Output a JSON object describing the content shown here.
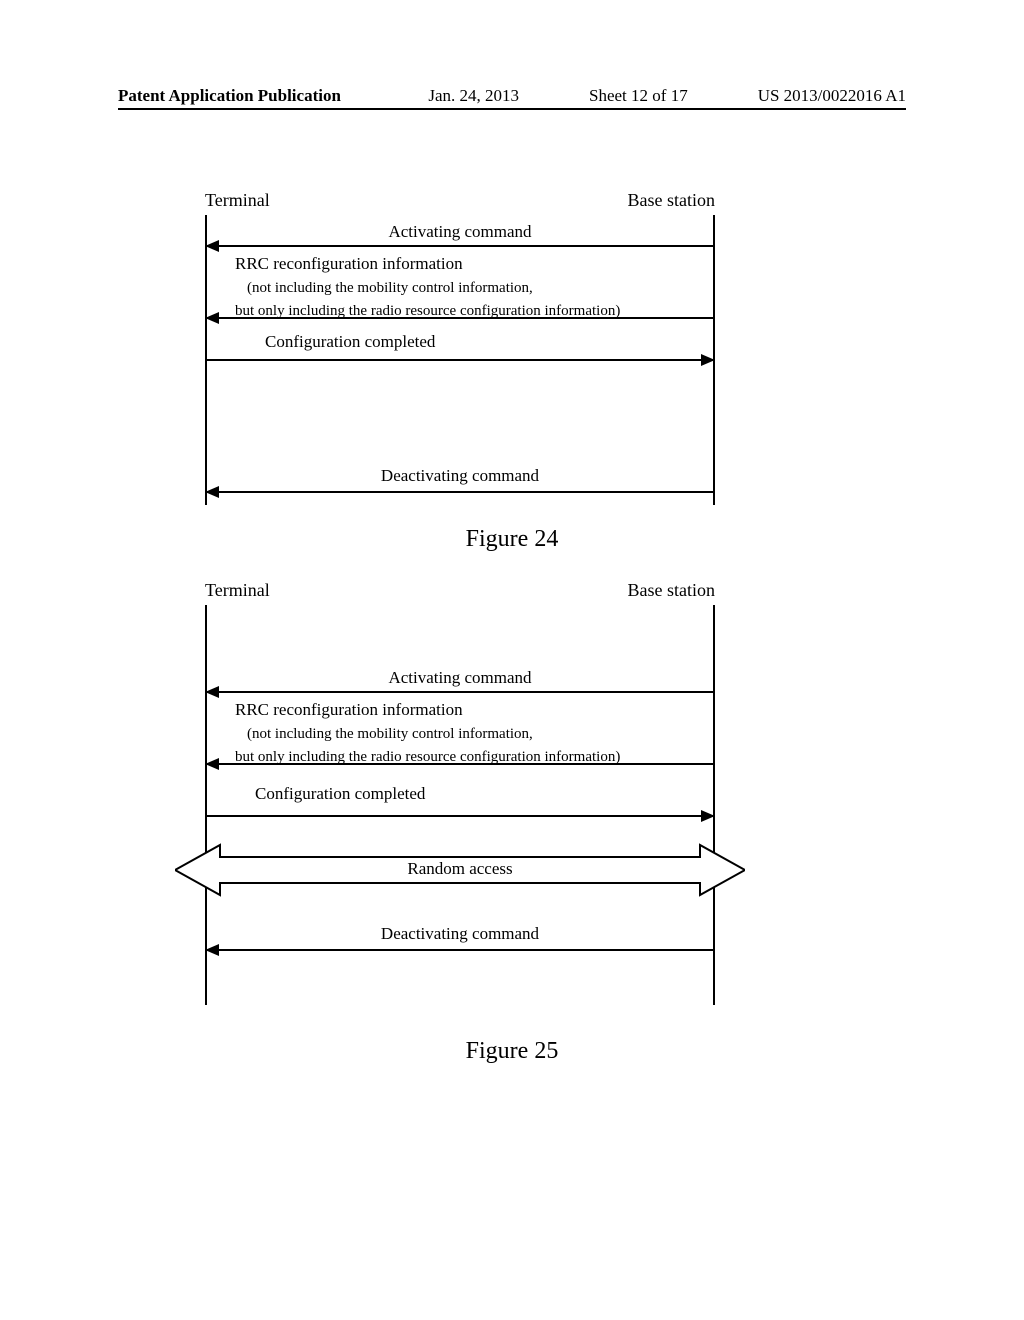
{
  "header": {
    "left": "Patent Application Publication",
    "date": "Jan. 24, 2013",
    "sheet": "Sheet 12 of 17",
    "docnum": "US 2013/0022016 A1"
  },
  "diagram": {
    "terminal_label": "Terminal",
    "base_station_label": "Base station",
    "activating": "Activating command",
    "rrc_title": "RRC reconfiguration information",
    "rrc_sub1": "(not including the mobility control information,",
    "rrc_sub2": "but only including the radio resource configuration information)",
    "config_completed": "Configuration completed",
    "random_access": "Random access",
    "deactivating": "Deactivating command"
  },
  "captions": {
    "fig24": "Figure 24",
    "fig25": "Figure 25"
  }
}
